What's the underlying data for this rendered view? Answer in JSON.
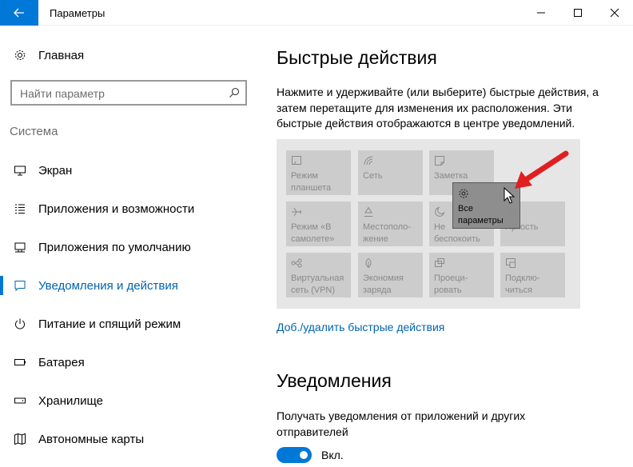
{
  "window": {
    "title": "Параметры"
  },
  "nav": {
    "home_label": "Главная",
    "search_placeholder": "Найти параметр",
    "section_label": "Система",
    "items": [
      {
        "label": "Экран",
        "icon": "monitor-icon"
      },
      {
        "label": "Приложения и возможности",
        "icon": "apps-list-icon"
      },
      {
        "label": "Приложения по умолчанию",
        "icon": "default-apps-icon"
      },
      {
        "label": "Уведомления и действия",
        "icon": "notification-icon",
        "active": true
      },
      {
        "label": "Питание и спящий режим",
        "icon": "power-icon"
      },
      {
        "label": "Батарея",
        "icon": "battery-icon"
      },
      {
        "label": "Хранилище",
        "icon": "storage-icon"
      },
      {
        "label": "Автономные карты",
        "icon": "offline-maps-icon"
      }
    ]
  },
  "main": {
    "quick_actions_title": "Быстрые действия",
    "quick_actions_description": "Нажмите и удерживайте (или выберите) быстрые действия, а затем перетащите для изменения их расположения. Эти быстрые действия отображаются в центре уведомлений.",
    "tiles": [
      {
        "label": "Режим\nпланшета",
        "icon": "tablet-mode-icon"
      },
      {
        "label": "Сеть",
        "icon": "network-icon"
      },
      {
        "label": "Заметка",
        "icon": "note-icon"
      },
      {
        "label": "",
        "icon": "empty"
      },
      {
        "label": "Режим «В\nсамолете»",
        "icon": "airplane-icon"
      },
      {
        "label": "Местополо-\nжение",
        "icon": "location-icon"
      },
      {
        "label": "Не\nбеспокоить",
        "icon": "moon-icon"
      },
      {
        "label": "Яркость",
        "icon": "brightness-icon"
      },
      {
        "label": "Виртуальная\nсеть (VPN)",
        "icon": "vpn-icon"
      },
      {
        "label": "Экономия\nзаряда",
        "icon": "battery-saver-icon"
      },
      {
        "label": "Проеци-\nровать",
        "icon": "project-icon"
      },
      {
        "label": "Подклю-\nчиться",
        "icon": "connect-icon"
      }
    ],
    "dragged_tile": {
      "label": "Все\nпараметры",
      "icon": "gear-icon"
    },
    "add_remove_link": "Доб./удалить быстрые действия",
    "notifications_title": "Уведомления",
    "notifications_description": "Получать уведомления от приложений и других отправителей",
    "toggle": {
      "state": "on",
      "label": "Вкл."
    }
  },
  "colors": {
    "accent": "#0078d7",
    "link": "#0063b1",
    "tile_bg": "#cccccc",
    "panel_bg": "#e6e6e6",
    "annotation_arrow": "#e02020"
  }
}
